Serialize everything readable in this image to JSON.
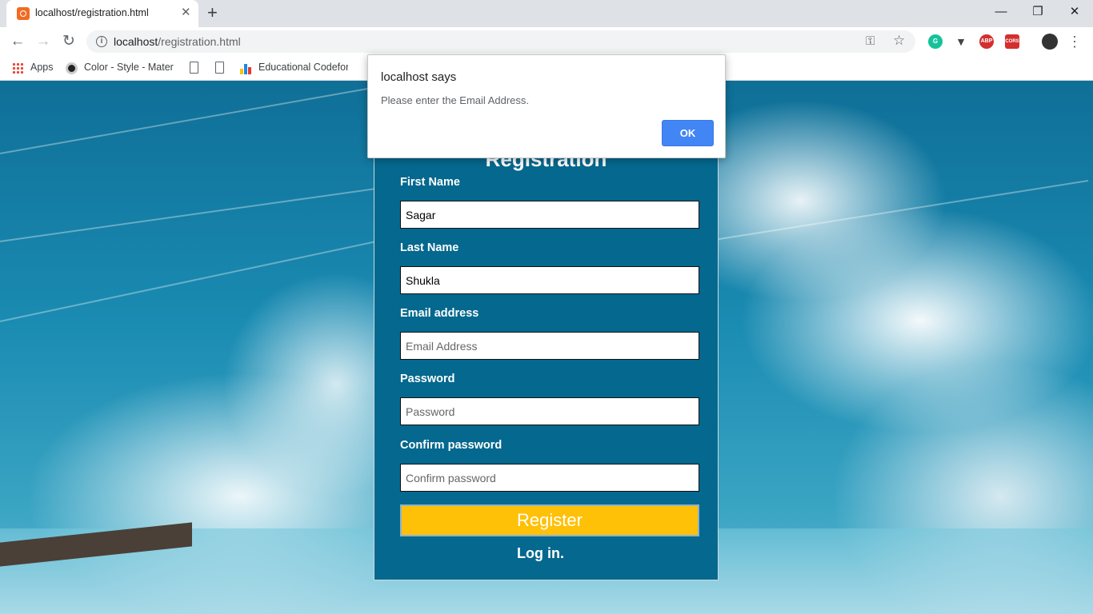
{
  "browser": {
    "tab_title": "localhost/registration.html",
    "tab_close": "✕",
    "new_tab": "+",
    "url_host": "localhost",
    "url_path": "/registration.html",
    "window_controls": {
      "minimize": "—",
      "maximize": "❐",
      "close": "✕"
    },
    "bookmarks": [
      {
        "label": "Apps"
      },
      {
        "label": "Color - Style - Materi"
      },
      {
        "label": "Educational Codeforc"
      }
    ],
    "extensions": [
      {
        "name": "grammarly",
        "color": "#15c39a",
        "label": "G"
      },
      {
        "name": "vpn",
        "color": "#444444",
        "label": ""
      },
      {
        "name": "adblock-plus",
        "color": "#d32f2f",
        "label": "ABP"
      },
      {
        "name": "cors",
        "color": "#d32f2f",
        "label": "CORS"
      }
    ]
  },
  "alert": {
    "title": "localhost says",
    "message": "Please enter the Email Address.",
    "ok_label": "OK"
  },
  "form": {
    "title": "Registration",
    "fields": [
      {
        "label": "First Name",
        "value": "Sagar",
        "placeholder": ""
      },
      {
        "label": "Last Name",
        "value": "Shukla",
        "placeholder": ""
      },
      {
        "label": "Email address",
        "value": "",
        "placeholder": "Email Address"
      },
      {
        "label": "Password",
        "value": "",
        "placeholder": "Password"
      },
      {
        "label": "Confirm password",
        "value": "",
        "placeholder": "Confirm password"
      }
    ],
    "register_label": "Register",
    "login_label": "Log in."
  },
  "colors": {
    "panel": "#05688e",
    "register_button": "#ffc107",
    "alert_ok": "#4285f4"
  }
}
